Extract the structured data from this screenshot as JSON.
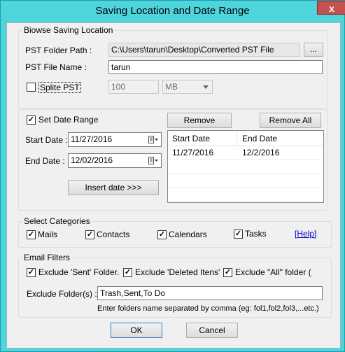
{
  "window": {
    "title": "Saving Location and Date Range",
    "close_glyph": "x"
  },
  "browse": {
    "legend": "Biowse Saving Location",
    "folder_label": "PST Folder Path :",
    "folder_value": "C:\\Users\\tarun\\Desktop\\Converted PST File",
    "browse_button": "...",
    "file_label": "PST File Name :",
    "file_value": "tarun",
    "split_label": "Splite PST",
    "split_checked": false,
    "split_size": "100",
    "split_unit": "MB"
  },
  "date": {
    "set_label": "Set Date Range",
    "set_checked": true,
    "start_label": "Start Date :",
    "start_value": "11/27/2016",
    "end_label": "End Date :",
    "end_value": "12/02/2016",
    "insert_button": "Insert date >>>",
    "remove_button": "Remove",
    "remove_all_button": "Remove All",
    "columns": [
      "Start Date",
      "End Date"
    ],
    "rows": [
      [
        "11/27/2016",
        "12/2/2016"
      ]
    ]
  },
  "categories": {
    "legend": "Select Categories",
    "items": [
      {
        "label": "Mails",
        "checked": true
      },
      {
        "label": "Contacts",
        "checked": true
      },
      {
        "label": "Calendars",
        "checked": true
      },
      {
        "label": "Tasks",
        "checked": true
      }
    ],
    "help_link": "[Help]"
  },
  "filters": {
    "legend": "Email Filters",
    "excl_sent": "Exclude 'Sent' Folder.",
    "excl_deleted": "Exclude 'Deleted Itens'",
    "excl_all": "Exclude \"All\" folder (",
    "folders_label": "Exclude Folder(s) :",
    "folders_value": "Trash,Sent,To Do",
    "hint": "Enter folders name separated by comma (eg: fol1,fol2,fol3,...etc.)"
  },
  "footer": {
    "ok": "OK",
    "cancel": "Cancel"
  }
}
